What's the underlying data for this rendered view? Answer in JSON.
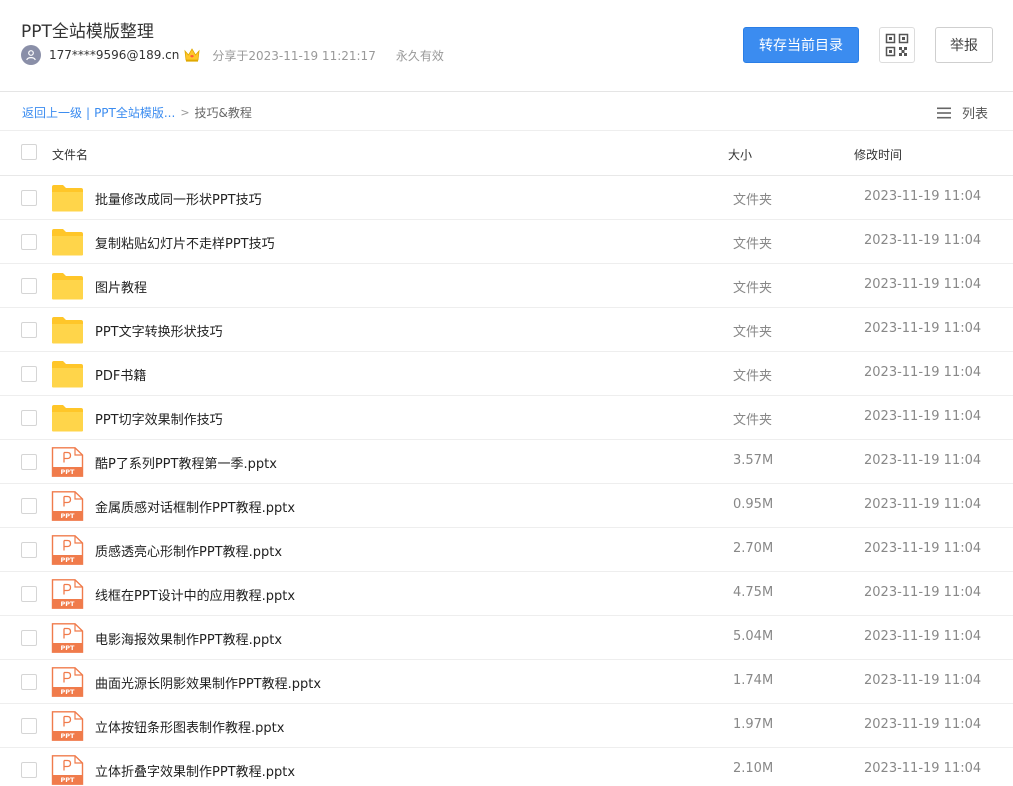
{
  "share": {
    "title": "PPT全站模版整理",
    "owner": "177****9596@189.cn",
    "shared_at": "分享于2023-11-19 11:21:17",
    "validity": "永久有效"
  },
  "actions": {
    "save_label": "转存当前目录",
    "report_label": "举报"
  },
  "breadcrumb": {
    "back": "返回上一级",
    "separator": "|",
    "parent": "PPT全站模版...",
    "arrow": ">",
    "current": "技巧&教程"
  },
  "view": {
    "label": "列表"
  },
  "columns": {
    "name": "文件名",
    "size": "大小",
    "time": "修改时间"
  },
  "colors": {
    "accent": "#3b8cf0",
    "folder": "#ffc629",
    "ppt": "#f07b4b"
  },
  "files": [
    {
      "type": "folder",
      "name": "批量修改成同一形状PPT技巧",
      "size": "文件夹",
      "time": "2023-11-19 11:04"
    },
    {
      "type": "folder",
      "name": "复制粘贴幻灯片不走样PPT技巧",
      "size": "文件夹",
      "time": "2023-11-19 11:04"
    },
    {
      "type": "folder",
      "name": "图片教程",
      "size": "文件夹",
      "time": "2023-11-19 11:04"
    },
    {
      "type": "folder",
      "name": "PPT文字转换形状技巧",
      "size": "文件夹",
      "time": "2023-11-19 11:04"
    },
    {
      "type": "folder",
      "name": "PDF书籍",
      "size": "文件夹",
      "time": "2023-11-19 11:04"
    },
    {
      "type": "folder",
      "name": "PPT切字效果制作技巧",
      "size": "文件夹",
      "time": "2023-11-19 11:04"
    },
    {
      "type": "ppt",
      "name": "酷P了系列PPT教程第一季.pptx",
      "size": "3.57M",
      "time": "2023-11-19 11:04"
    },
    {
      "type": "ppt",
      "name": "金属质感对话框制作PPT教程.pptx",
      "size": "0.95M",
      "time": "2023-11-19 11:04"
    },
    {
      "type": "ppt",
      "name": "质感透亮心形制作PPT教程.pptx",
      "size": "2.70M",
      "time": "2023-11-19 11:04"
    },
    {
      "type": "ppt",
      "name": "线框在PPT设计中的应用教程.pptx",
      "size": "4.75M",
      "time": "2023-11-19 11:04"
    },
    {
      "type": "ppt",
      "name": "电影海报效果制作PPT教程.pptx",
      "size": "5.04M",
      "time": "2023-11-19 11:04"
    },
    {
      "type": "ppt",
      "name": "曲面光源长阴影效果制作PPT教程.pptx",
      "size": "1.74M",
      "time": "2023-11-19 11:04"
    },
    {
      "type": "ppt",
      "name": "立体按钮条形图表制作教程.pptx",
      "size": "1.97M",
      "time": "2023-11-19 11:04"
    },
    {
      "type": "ppt",
      "name": "立体折叠字效果制作PPT教程.pptx",
      "size": "2.10M",
      "time": "2023-11-19 11:04"
    }
  ]
}
